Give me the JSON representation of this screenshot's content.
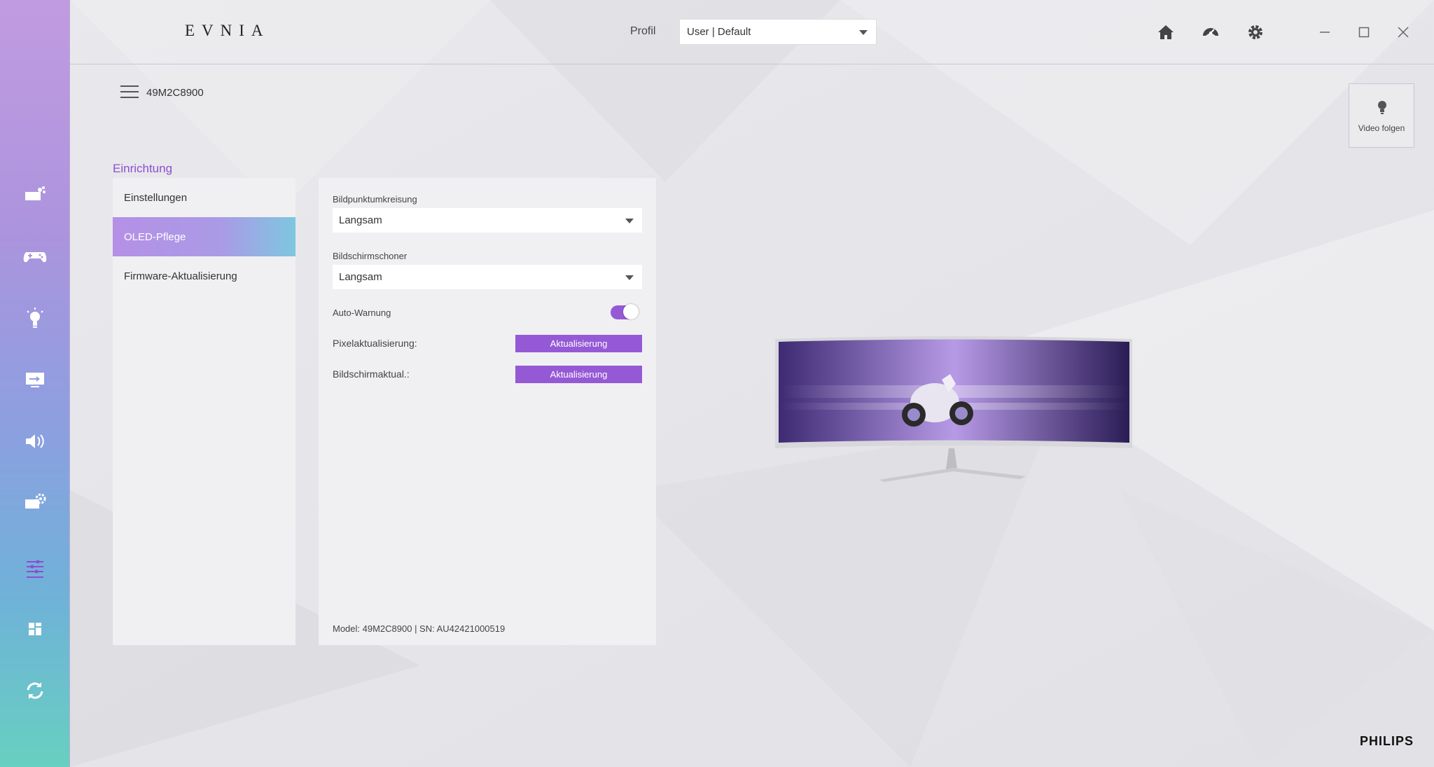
{
  "app": {
    "brand": "EVNIA",
    "footer_brand": "PHILIPS"
  },
  "header": {
    "profile_label": "Profil",
    "profile_value": "User | Default"
  },
  "device": {
    "model": "49M2C8900"
  },
  "video_button": {
    "label": "Video folgen"
  },
  "sidebar": {
    "items": [
      {
        "name": "smart-image-icon"
      },
      {
        "name": "gaming-icon"
      },
      {
        "name": "light-icon"
      },
      {
        "name": "input-icon"
      },
      {
        "name": "audio-icon"
      },
      {
        "name": "monitor-settings-icon"
      },
      {
        "name": "settings-sliders-icon"
      },
      {
        "name": "layout-icon"
      },
      {
        "name": "sync-icon"
      }
    ],
    "active_index": 6
  },
  "setup": {
    "title": "Einrichtung",
    "menu": [
      "Einstellungen",
      "OLED-Pflege",
      "Firmware-Aktualisierung"
    ],
    "active_menu_index": 1
  },
  "oled_care": {
    "pixel_orbit_label": "Bildpunktumkreisung",
    "pixel_orbit_value": "Langsam",
    "screensaver_label": "Bildschirmschoner",
    "screensaver_value": "Langsam",
    "auto_warning_label": "Auto-Warnung",
    "auto_warning_on": true,
    "pixel_refresh_label": "Pixelaktualisierung:",
    "pixel_refresh_button": "Aktualisierung",
    "screen_refresh_label": "Bildschirmaktual.:",
    "screen_refresh_button": "Aktualisierung",
    "footer": "Model: 49M2C8900 | SN: AU42421000519"
  },
  "colors": {
    "accent": "#9559d6",
    "section_title": "#8b4fd0"
  }
}
